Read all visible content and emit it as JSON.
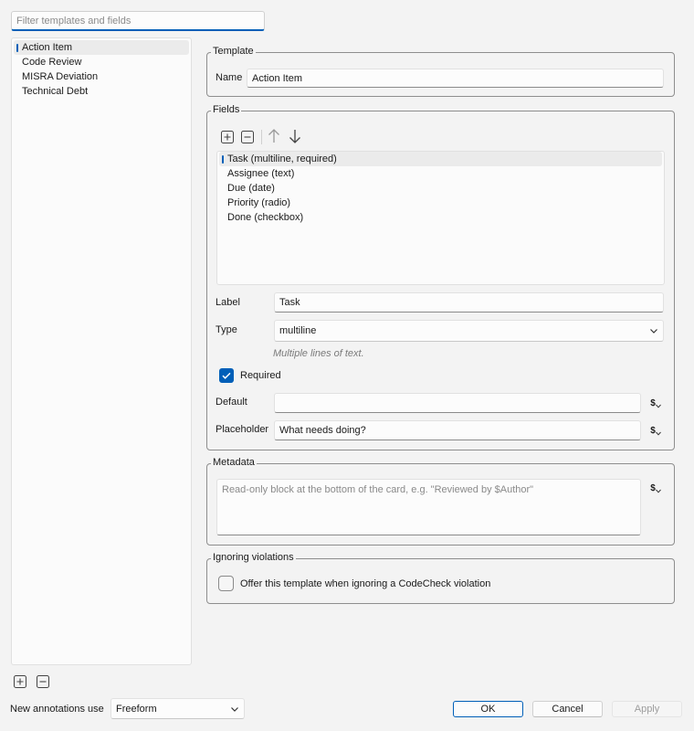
{
  "filter": {
    "placeholder": "Filter templates and fields"
  },
  "templates": {
    "items": [
      "Action Item",
      "Code Review",
      "MISRA Deviation",
      "Technical Debt"
    ],
    "selected_index": 0
  },
  "template_group": {
    "legend": "Template",
    "name_label": "Name",
    "name_value": "Action Item"
  },
  "fields_group": {
    "legend": "Fields",
    "fields": [
      "Task (multiline, required)",
      "Assignee (text)",
      "Due (date)",
      "Priority (radio)",
      "Done (checkbox)"
    ],
    "selected_index": 0,
    "label_label": "Label",
    "label_value": "Task",
    "type_label": "Type",
    "type_value": "multiline",
    "type_hint": "Multiple lines of text.",
    "required_label": "Required",
    "required_checked": true,
    "default_label": "Default",
    "default_value": "",
    "placeholder_label": "Placeholder",
    "placeholder_value": "What needs doing?"
  },
  "metadata_group": {
    "legend": "Metadata",
    "placeholder": "Read-only block at the bottom of the card, e.g. \"Reviewed by $Author\""
  },
  "ignoring_group": {
    "legend": "Ignoring violations",
    "offer_label": "Offer this template when ignoring a CodeCheck violation",
    "offer_checked": false
  },
  "footer": {
    "new_annotations_label": "New annotations use",
    "new_annotations_value": "Freeform",
    "ok_label": "OK",
    "cancel_label": "Cancel",
    "apply_label": "Apply"
  },
  "dollar_symbol": "$",
  "colors": {
    "accent": "#005fb8",
    "background": "#f3f3f3"
  }
}
